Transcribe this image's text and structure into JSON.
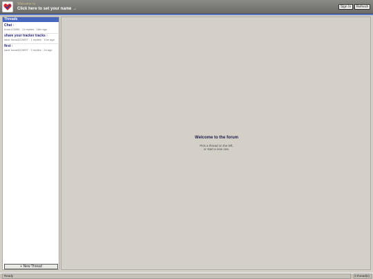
{
  "header": {
    "logo_icon": "heart-check-logo-icon",
    "welcome_label": "Welcome to",
    "set_name_label": "Click here to set your name →",
    "sign_in_label": "Sign In",
    "refresh_label": "Refresh",
    "accent_color": "#5a75c8"
  },
  "sidebar": {
    "title": "Threads",
    "title_color": "#4868c0",
    "threads": [
      {
        "title": "Chat",
        "arrow": "›",
        "meta": "frodo123456 · 11 replies · 18m ago"
      },
      {
        "title": "share your tracker tracks",
        "arrow": "›",
        "meta": "sauir houstZZ2MST · 1 replies · 10m ago"
      },
      {
        "title": "first",
        "arrow": "›",
        "meta": "sauir houstZZ2MST · 0 replies · 2d ago"
      }
    ],
    "new_thread_label": "+ New Thread"
  },
  "main": {
    "title": "Welcome to the forum",
    "subtitle_line1": "Pick a thread on the left,",
    "subtitle_line2": "or start a new one."
  },
  "status": {
    "left": "Ready",
    "right": "3 thread(s)"
  }
}
